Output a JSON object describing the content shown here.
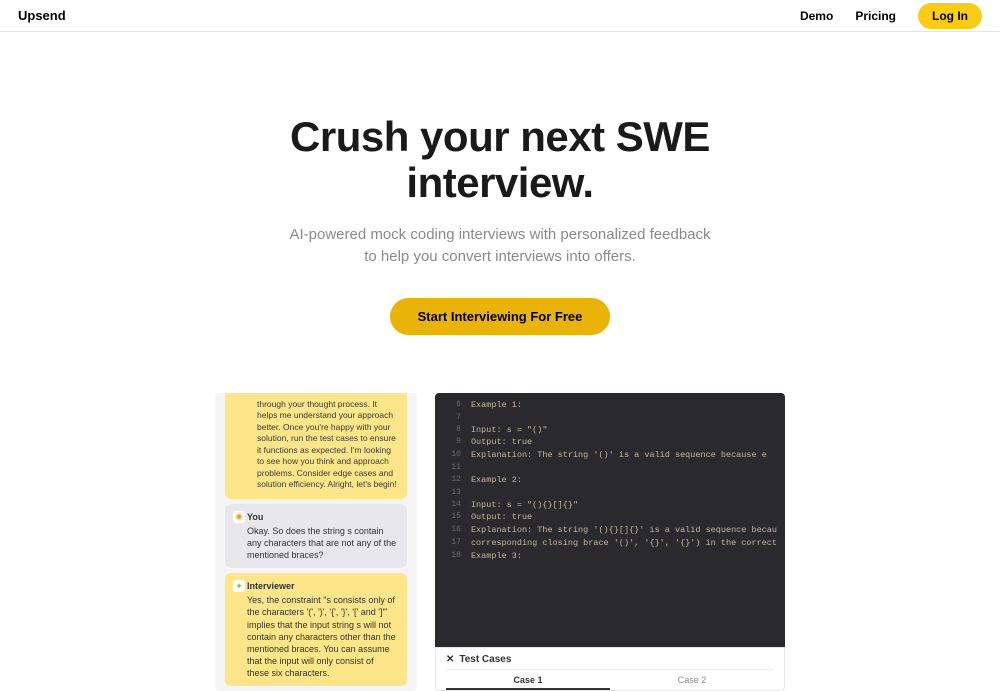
{
  "header": {
    "logo": "Upsend",
    "nav": {
      "demo": "Demo",
      "pricing": "Pricing",
      "login": "Log In"
    }
  },
  "hero": {
    "title_line1": "Crush your next SWE",
    "title_line2": "interview.",
    "subtitle_line1": "AI-powered mock coding interviews with personalized feedback",
    "subtitle_line2": "to help you convert interviews into offers.",
    "cta": "Start Interviewing For Free"
  },
  "chat": {
    "top": "through your thought process. It helps me understand your approach better. Once you're happy with your solution, run the test cases to ensure it functions as expected. I'm looking to see how you think and approach problems. Consider edge cases and solution efficiency. Alright, let's begin!",
    "you_name": "You",
    "you_text": "Okay. So does the string s contain any characters that are not any of the mentioned braces?",
    "int_name": "Interviewer",
    "int_text": "Yes, the constraint \"s consists only of the characters '(', ')', '{', '}', '[' and ']'\" implies that the input string s will not contain any characters other than the mentioned braces. You can assume that the input will only consist of these six characters."
  },
  "code": {
    "lines": [
      {
        "n": "6",
        "t": "Example 1:"
      },
      {
        "n": "7",
        "t": ""
      },
      {
        "n": "8",
        "t": "Input: s = \"()\""
      },
      {
        "n": "9",
        "t": "Output: true"
      },
      {
        "n": "10",
        "t": "Explanation: The string '()' is a valid sequence because e"
      },
      {
        "n": "11",
        "t": ""
      },
      {
        "n": "12",
        "t": "Example 2:"
      },
      {
        "n": "13",
        "t": ""
      },
      {
        "n": "14",
        "t": "Input: s = \"(){}[]{}\""
      },
      {
        "n": "15",
        "t": "Output: true"
      },
      {
        "n": "16",
        "t": "Explanation: The string '(){}[]{}' is a valid sequence becau"
      },
      {
        "n": "17",
        "t": "corresponding closing brace '()', '{}', '{}') in the correct"
      },
      {
        "n": "18",
        "t": "Example 3:"
      }
    ]
  },
  "testcases": {
    "title": "Test Cases",
    "tab1": "Case 1",
    "tab2": "Case 2"
  }
}
